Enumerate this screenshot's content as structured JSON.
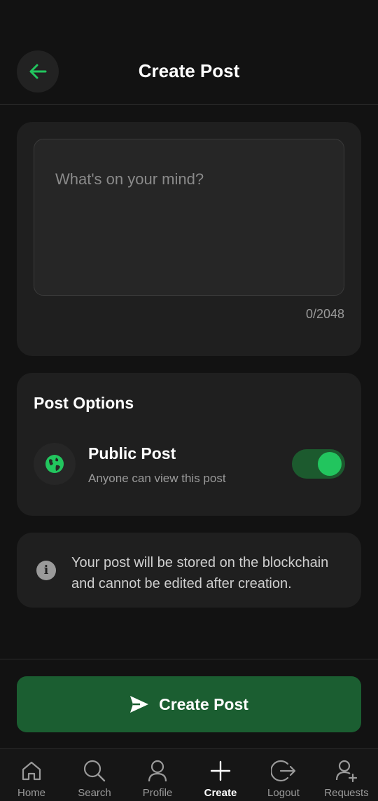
{
  "header": {
    "title": "Create Post"
  },
  "compose": {
    "placeholder": "What's on your mind?",
    "counter": "0/2048"
  },
  "options": {
    "title": "Post Options",
    "public_label": "Public Post",
    "public_sub": "Anyone can view this post",
    "public_enabled": true
  },
  "info": {
    "text": "Your post will be stored on the blockchain and cannot be edited after creation."
  },
  "action": {
    "label": "Create Post"
  },
  "tabs": [
    {
      "label": "Home",
      "icon": "home-icon"
    },
    {
      "label": "Search",
      "icon": "search-icon"
    },
    {
      "label": "Profile",
      "icon": "profile-icon"
    },
    {
      "label": "Create",
      "icon": "plus-icon",
      "active": true
    },
    {
      "label": "Logout",
      "icon": "logout-icon"
    },
    {
      "label": "Requests",
      "icon": "add-user-icon"
    }
  ],
  "colors": {
    "accent": "#22c55e",
    "button": "#1b5e31",
    "background": "#121212",
    "card": "#1f1f1f"
  }
}
